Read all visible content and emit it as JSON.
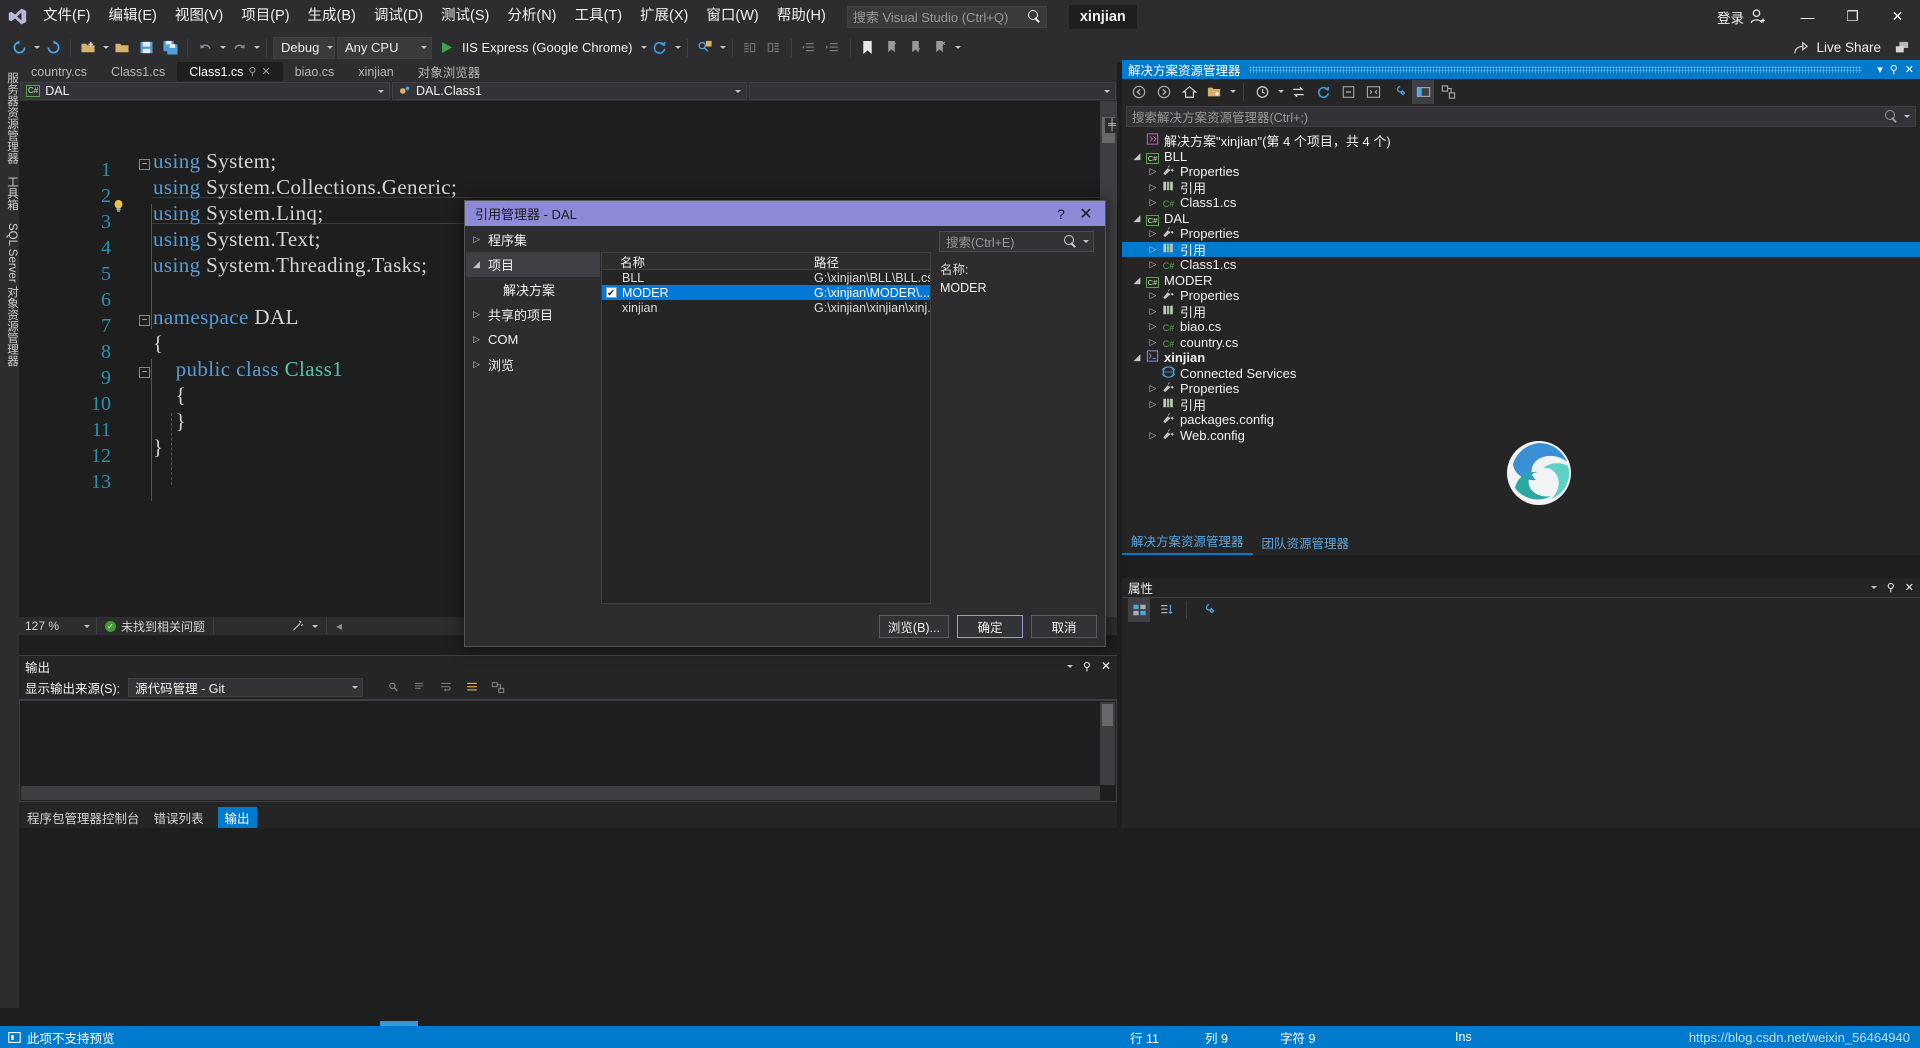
{
  "app": {
    "solution_name": "xinjian",
    "signin_label": "登录",
    "live_share_label": "Live Share"
  },
  "menu": {
    "items": [
      "文件(F)",
      "编辑(E)",
      "视图(V)",
      "项目(P)",
      "生成(B)",
      "调试(D)",
      "测试(S)",
      "分析(N)",
      "工具(T)",
      "扩展(X)",
      "窗口(W)",
      "帮助(H)"
    ]
  },
  "quick_search": {
    "placeholder": "搜索 Visual Studio (Ctrl+Q)",
    "icon": "search-icon"
  },
  "window_buttons": {
    "minimize": "—",
    "maximize": "❐",
    "close": "✕"
  },
  "toolbar": {
    "config": "Debug",
    "platform": "Any CPU",
    "run_target": "IIS Express (Google Chrome)"
  },
  "left_dock": {
    "tabs": [
      "服务器资源管理器",
      "工具箱",
      "SQL Server 对象资源管理器"
    ]
  },
  "editor": {
    "tabs": [
      {
        "label": "country.cs",
        "active": false
      },
      {
        "label": "Class1.cs",
        "active": false
      },
      {
        "label": "Class1.cs",
        "active": true
      },
      {
        "label": "biao.cs",
        "active": false
      },
      {
        "label": "xinjian",
        "active": false
      },
      {
        "label": "对象浏览器",
        "active": false
      }
    ],
    "nav_namespace": "DAL",
    "nav_member": "DAL.Class1",
    "line_numbers": [
      "1",
      "2",
      "3",
      "4",
      "5",
      "6",
      "7",
      "8",
      "9",
      "10",
      "11",
      "12",
      "13"
    ],
    "code": [
      "using System;",
      "using System.Collections.Generic;",
      "using System.Linq;",
      "using System.Text;",
      "using System.Threading.Tasks;",
      "",
      "namespace DAL",
      "{",
      "    public class Class1",
      "    {",
      "    }",
      "}",
      ""
    ],
    "zoom": "127 %",
    "error_status": "未找到相关问题"
  },
  "output": {
    "title": "输出",
    "source_label": "显示输出来源(S):",
    "source_value": "源代码管理 - Git",
    "tabs": [
      {
        "label": "程序包管理器控制台",
        "active": false
      },
      {
        "label": "错误列表",
        "active": false
      },
      {
        "label": "输出",
        "active": true
      }
    ]
  },
  "solution_explorer": {
    "title": "解决方案资源管理器",
    "search_placeholder": "搜索解决方案资源管理器(Ctrl+;)",
    "tree": [
      {
        "depth": 0,
        "arrow": "",
        "icon": "solution-icon",
        "label": "解决方案\"xinjian\"(第 4 个项目，共 4 个)",
        "bold": false,
        "selected": false
      },
      {
        "depth": 0,
        "arrow": "▲",
        "icon": "csharp-icon",
        "label": "BLL",
        "bold": false,
        "selected": false
      },
      {
        "depth": 1,
        "arrow": "▶",
        "icon": "wrench-icon",
        "label": "Properties",
        "bold": false,
        "selected": false
      },
      {
        "depth": 1,
        "arrow": "▶",
        "icon": "reference-icon",
        "label": "引用",
        "bold": false,
        "selected": false
      },
      {
        "depth": 1,
        "arrow": "▶",
        "icon": "cs-file-icon",
        "label": "Class1.cs",
        "bold": false,
        "selected": false
      },
      {
        "depth": 0,
        "arrow": "▲",
        "icon": "csharp-icon",
        "label": "DAL",
        "bold": false,
        "selected": false
      },
      {
        "depth": 1,
        "arrow": "▶",
        "icon": "wrench-icon",
        "label": "Properties",
        "bold": false,
        "selected": false
      },
      {
        "depth": 1,
        "arrow": "▶",
        "icon": "reference-icon",
        "label": "引用",
        "bold": false,
        "selected": true
      },
      {
        "depth": 1,
        "arrow": "▶",
        "icon": "cs-file-icon",
        "label": "Class1.cs",
        "bold": false,
        "selected": false
      },
      {
        "depth": 0,
        "arrow": "▲",
        "icon": "csharp-icon",
        "label": "MODER",
        "bold": false,
        "selected": false
      },
      {
        "depth": 1,
        "arrow": "▶",
        "icon": "wrench-icon",
        "label": "Properties",
        "bold": false,
        "selected": false
      },
      {
        "depth": 1,
        "arrow": "▶",
        "icon": "reference-icon",
        "label": "引用",
        "bold": false,
        "selected": false
      },
      {
        "depth": 1,
        "arrow": "▶",
        "icon": "cs-file-icon",
        "label": "biao.cs",
        "bold": false,
        "selected": false
      },
      {
        "depth": 1,
        "arrow": "▶",
        "icon": "cs-file-icon",
        "label": "country.cs",
        "bold": false,
        "selected": false
      },
      {
        "depth": 0,
        "arrow": "▲",
        "icon": "web-project-icon",
        "label": "xinjian",
        "bold": true,
        "selected": false
      },
      {
        "depth": 1,
        "arrow": "",
        "icon": "services-icon",
        "label": "Connected Services",
        "bold": false,
        "selected": false
      },
      {
        "depth": 1,
        "arrow": "▶",
        "icon": "wrench-icon",
        "label": "Properties",
        "bold": false,
        "selected": false
      },
      {
        "depth": 1,
        "arrow": "▶",
        "icon": "reference-icon",
        "label": "引用",
        "bold": false,
        "selected": false
      },
      {
        "depth": 1,
        "arrow": "",
        "icon": "config-icon",
        "label": "packages.config",
        "bold": false,
        "selected": false
      },
      {
        "depth": 1,
        "arrow": "▶",
        "icon": "config-icon",
        "label": "Web.config",
        "bold": false,
        "selected": false
      }
    ],
    "bottom_tabs": [
      {
        "label": "解决方案资源管理器",
        "active": true
      },
      {
        "label": "团队资源管理器",
        "active": false
      }
    ]
  },
  "properties_panel": {
    "title": "属性"
  },
  "dialog": {
    "title": "引用管理器 - DAL",
    "help_glyph": "?",
    "close_glyph": "✕",
    "search_placeholder": "搜索(Ctrl+E)",
    "categories": [
      {
        "label": "程序集",
        "arrow": "▶",
        "selected": false,
        "sub": false
      },
      {
        "label": "项目",
        "arrow": "▲",
        "selected": true,
        "sub": false
      },
      {
        "label": "解决方案",
        "arrow": "",
        "selected": false,
        "sub": true
      },
      {
        "label": "共享的项目",
        "arrow": "▶",
        "selected": false,
        "sub": false
      },
      {
        "label": "COM",
        "arrow": "▶",
        "selected": false,
        "sub": false
      },
      {
        "label": "浏览",
        "arrow": "▶",
        "selected": false,
        "sub": false
      }
    ],
    "columns": {
      "name": "名称",
      "path": "路径"
    },
    "rows": [
      {
        "checked": false,
        "name": "BLL",
        "path": "G:\\xinjian\\BLL\\BLL.cs...",
        "selected": false
      },
      {
        "checked": true,
        "name": "MODER",
        "path": "G:\\xinjian\\MODER\\...",
        "selected": true
      },
      {
        "checked": false,
        "name": "xinjian",
        "path": "G:\\xinjian\\xinjian\\xinj...",
        "selected": false
      }
    ],
    "detail": {
      "name_label": "名称:",
      "name_value": "MODER"
    },
    "buttons": {
      "browse": "浏览(B)...",
      "ok": "确定",
      "cancel": "取消"
    }
  },
  "status_bar": {
    "message": "此项不支持预览",
    "row_label": "行 11",
    "col_label": "列 9",
    "char_label": "字符 9",
    "insert_mode": "Ins",
    "watermark": "https://blog.csdn.net/weixin_56464940"
  },
  "colors": {
    "accent_blue": "#007acc",
    "dialog_title": "#8d8ad8",
    "selection_blue": "#0078d7",
    "chrome_dark": "#2d2d30",
    "editor_bg": "#1e1e1e"
  }
}
